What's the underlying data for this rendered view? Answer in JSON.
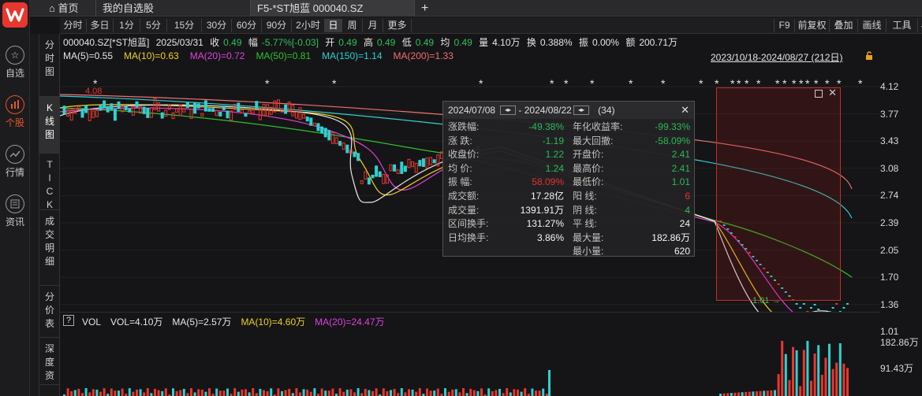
{
  "topbar": {
    "home_label": "首页",
    "watchlist_label": "我的自选股",
    "active_tab_label": "F5-*ST旭蓝 000040.SZ",
    "add_label": "+"
  },
  "leftnav": [
    {
      "label": "自选",
      "icon": "star-icon"
    },
    {
      "label": "个股",
      "icon": "candlestick-icon"
    },
    {
      "label": "行情",
      "icon": "trend-icon"
    },
    {
      "label": "资讯",
      "icon": "news-icon"
    }
  ],
  "periods": [
    "分时",
    "多日",
    "1分",
    "5分",
    "15分",
    "30分",
    "60分",
    "90分",
    "2小时",
    "日",
    "周",
    "月",
    "更多"
  ],
  "active_period": "日",
  "tools": [
    "F9",
    "前复权",
    "叠加",
    "画线",
    "工具"
  ],
  "sidetabs": [
    "分时图",
    "K线图",
    "TICK",
    "成交明细",
    "分价表",
    "深度资"
  ],
  "quote": {
    "code": "000040.SZ[*ST旭蓝]",
    "date": "2025/03/31",
    "close_label": "收",
    "close": "0.49",
    "chg_label": "幅",
    "chg": "-5.77%[-0.03]",
    "open_label": "开",
    "open": "0.49",
    "high_label": "高",
    "high": "0.49",
    "low_label": "低",
    "low": "0.49",
    "avg_label": "均",
    "avg": "0.49",
    "vol_label": "量",
    "vol": "4.10万",
    "turn_label": "换",
    "turn": "0.388%",
    "amp_label": "振",
    "amp": "0.00%",
    "amt_label": "额",
    "amt": "200.71万"
  },
  "ma": [
    {
      "label": "MA(5)=0.55",
      "color": "#e6e6e6"
    },
    {
      "label": "MA(10)=0.63",
      "color": "#f0d020"
    },
    {
      "label": "MA(20)=0.72",
      "color": "#e040e0"
    },
    {
      "label": "MA(50)=0.81",
      "color": "#30c030"
    },
    {
      "label": "MA(150)=1.14",
      "color": "#30d0d0"
    },
    {
      "label": "MA(200)=1.33",
      "color": "#f07070"
    }
  ],
  "date_range": "2023/10/18-2024/08/27 (212日)",
  "price_axis": [
    "4.12",
    "3.77",
    "3.43",
    "3.08",
    "2.74",
    "2.39",
    "2.05",
    "1.70",
    "1.36",
    "1.01"
  ],
  "annotations": {
    "high_mark": "4.08",
    "low_mark": "1.01"
  },
  "popup": {
    "start": "2024/07/08",
    "sep": "-",
    "end": "2024/08/22",
    "count": "(34)",
    "left": [
      {
        "k": "涨跌幅:",
        "v": "-49.38%",
        "c": "#2fbf5a"
      },
      {
        "k": "涨  跌:",
        "v": "-1.19",
        "c": "#2fbf5a"
      },
      {
        "k": "收盘价:",
        "v": "1.22",
        "c": "#2fbf5a"
      },
      {
        "k": "均  价:",
        "v": "1.24",
        "c": "#2fbf5a"
      },
      {
        "k": "振  幅:",
        "v": "58.09%",
        "c": "#e8372e"
      },
      {
        "k": "成交额:",
        "v": "17.28亿",
        "c": "#ffffff"
      },
      {
        "k": "成交量:",
        "v": "1391.91万",
        "c": "#ffffff"
      },
      {
        "k": "区间换手:",
        "v": "131.27%",
        "c": "#ffffff"
      },
      {
        "k": "日均换手:",
        "v": "3.86%",
        "c": "#ffffff"
      }
    ],
    "right": [
      {
        "k": "年化收益率:",
        "v": "-99.33%",
        "c": "#2fbf5a"
      },
      {
        "k": "最大回撤:",
        "v": "-58.09%",
        "c": "#2fbf5a"
      },
      {
        "k": "开盘价:",
        "v": "2.41",
        "c": "#2fbf5a"
      },
      {
        "k": "最高价:",
        "v": "2.41",
        "c": "#2fbf5a"
      },
      {
        "k": "最低价:",
        "v": "1.01",
        "c": "#2fbf5a"
      },
      {
        "k": "阳  线:",
        "v": "6",
        "c": "#e8372e"
      },
      {
        "k": "阴  线:",
        "v": "4",
        "c": "#2fbf5a"
      },
      {
        "k": "平  线:",
        "v": "24",
        "c": "#ffffff"
      },
      {
        "k": "最大量:",
        "v": "182.86万",
        "c": "#ffffff"
      },
      {
        "k": "最小量:",
        "v": "620",
        "c": "#ffffff"
      }
    ]
  },
  "volume": {
    "help": "?",
    "items": [
      {
        "label": "VOL",
        "color": "#e6e6e6"
      },
      {
        "label": "VOL=4.10万",
        "color": "#e6e6e6"
      },
      {
        "label": "MA(5)=2.57万",
        "color": "#e6e6e6"
      },
      {
        "label": "MA(10)=4.60万",
        "color": "#f0d020"
      },
      {
        "label": "MA(20)=24.47万",
        "color": "#e040e0"
      }
    ],
    "axis": [
      "182.86万",
      "91.43万"
    ]
  },
  "colors": {
    "up": "#e8372e",
    "down": "#2fbf5a",
    "cyan": "#30d0d0",
    "accent": "#e8542a"
  }
}
